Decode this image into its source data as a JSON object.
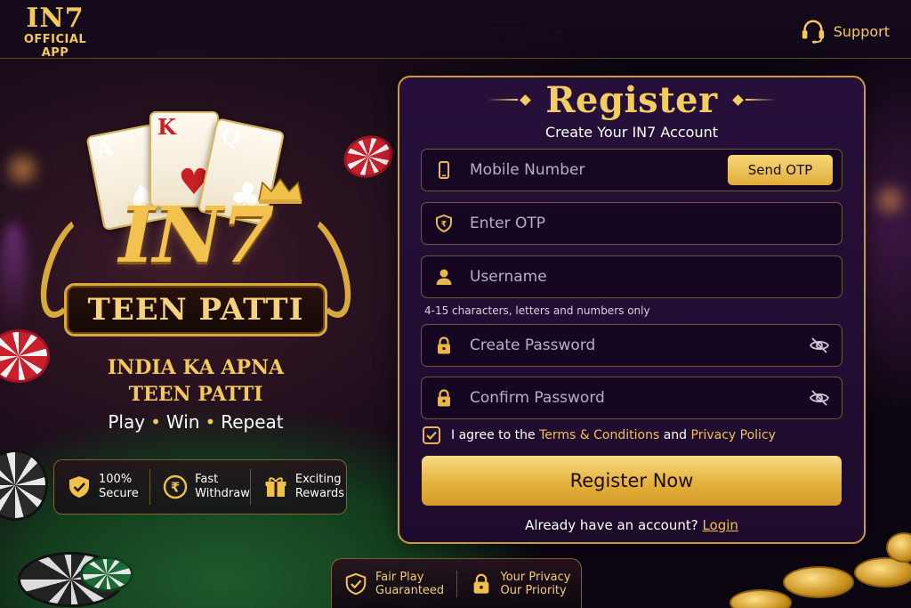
{
  "header": {
    "logo_line1": "IN7",
    "logo_line2": "OFFICIAL",
    "logo_line3": "APP",
    "support_label": "Support",
    "support_icon": "headset-icon"
  },
  "hero": {
    "cards": [
      {
        "rank": "A",
        "suit": "♠",
        "color": "#111111"
      },
      {
        "rank": "K",
        "suit": "♥",
        "color": "#c81e24"
      },
      {
        "rank": "Q",
        "suit": "♣",
        "color": "#111111"
      }
    ],
    "brand": "IN7",
    "banner": "TEEN PATTI",
    "tagline_line1": "INDIA KA APNA",
    "tagline_line2": "TEEN PATTI",
    "slogan": [
      "Play",
      "Win",
      "Repeat"
    ],
    "features": [
      {
        "icon": "shield-check-icon",
        "line1": "100%",
        "line2": "Secure"
      },
      {
        "icon": "rupee-coin-icon",
        "line1": "Fast",
        "line2": "Withdraw"
      },
      {
        "icon": "gift-icon",
        "line1": "Exciting",
        "line2": "Rewards"
      }
    ]
  },
  "register": {
    "title": "Register",
    "subtitle": "Create Your IN7 Account",
    "mobile": {
      "placeholder": "Mobile Number",
      "value": "",
      "icon": "phone-icon"
    },
    "send_otp_label": "Send OTP",
    "otp": {
      "placeholder": "Enter OTP",
      "value": "",
      "icon": "otp-shield-icon"
    },
    "username": {
      "placeholder": "Username",
      "value": "",
      "icon": "user-icon"
    },
    "username_hint": "4-15 characters, letters and numbers only",
    "password": {
      "placeholder": "Create Password",
      "value": "",
      "icon": "lock-icon"
    },
    "confirm_password": {
      "placeholder": "Confirm Password",
      "value": "",
      "icon": "lock-icon"
    },
    "agree": {
      "checked": true,
      "prefix": "I agree to the",
      "terms_link": "Terms & Conditions",
      "and": "and",
      "privacy_link": "Privacy Policy"
    },
    "submit_label": "Register Now",
    "login_prompt": "Already have an account?",
    "login_link": "Login"
  },
  "trust": [
    {
      "icon": "shield-check-icon",
      "line1": "Fair Play",
      "line2": "Guaranteed"
    },
    {
      "icon": "lock-icon",
      "line1": "Your Privacy",
      "line2": "Our Priority"
    }
  ],
  "colors": {
    "gold": "#f3c14d",
    "panel_bg": "#24103a",
    "accent_button": "#e5b13d"
  }
}
